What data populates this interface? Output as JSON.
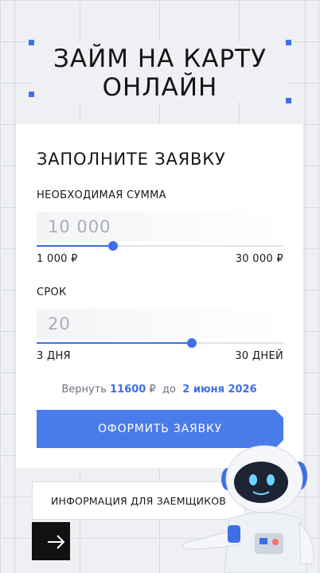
{
  "hero": {
    "title_line1": "ЗАЙМ НА КАРТУ",
    "title_line2": "ОНЛАЙН"
  },
  "form": {
    "title": "ЗАПОЛНИТЕ ЗАЯВКУ",
    "amount": {
      "label": "НЕОБХОДИМАЯ СУММА",
      "value": "10 000",
      "min_label": "1 000 ₽",
      "max_label": "30 000 ₽",
      "slider_fraction": 0.31
    },
    "term": {
      "label": "СРОК",
      "value": "20",
      "min_label": "3 ДНЯ",
      "max_label": "30 ДНЕЙ",
      "slider_fraction": 0.63
    },
    "return": {
      "prefix": "Вернуть",
      "amount": "11600",
      "currency": "₽",
      "middle": "до",
      "date": "2 июня 2026"
    },
    "submit_label": "ОФОРМИТЬ ЗАЯВКУ"
  },
  "footer": {
    "info_label": "ИНФОРМАЦИЯ ДЛЯ ЗАЕМЩИКОВ",
    "arrow_icon": "arrow-right-icon"
  },
  "colors": {
    "accent": "#3e6fe6",
    "button": "#4a7bea",
    "dark": "#111111"
  }
}
